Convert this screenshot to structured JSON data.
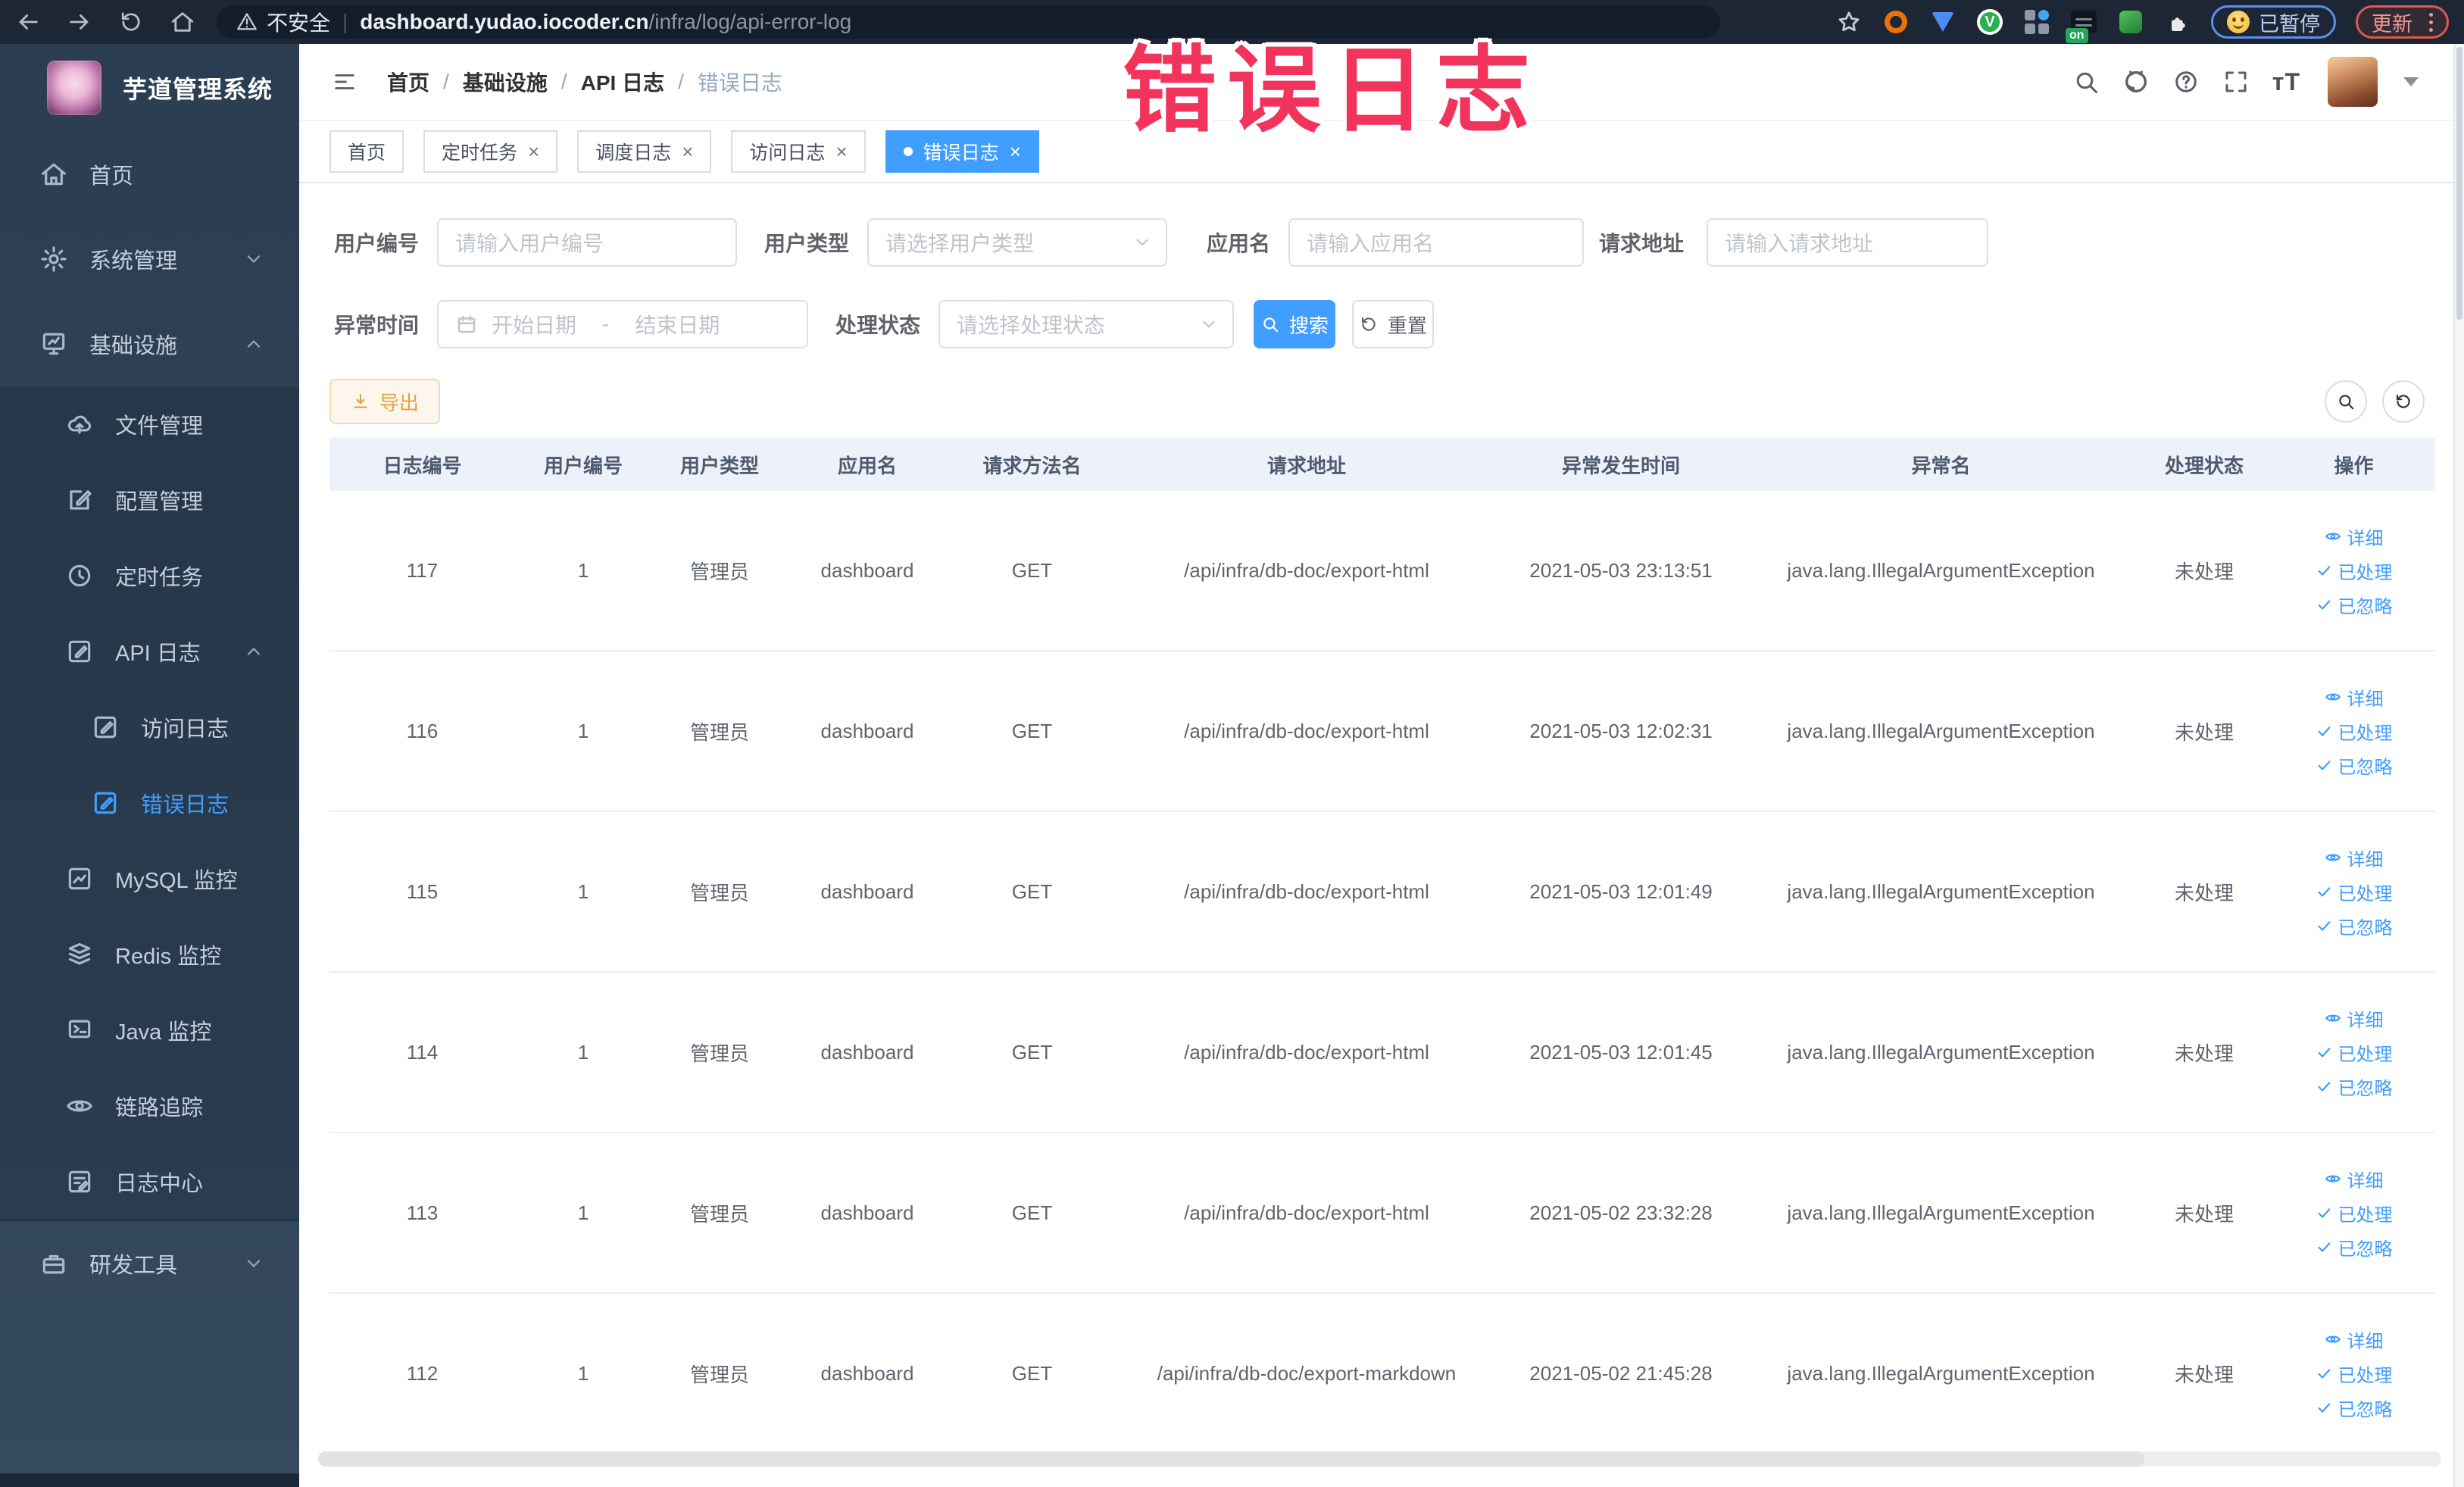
{
  "browser": {
    "security_label": "不安全",
    "url_host": "dashboard.yudao.iocoder.cn",
    "url_path": "/infra/log/api-error-log",
    "on_badge": "on",
    "paused_badge": "已暂停",
    "update_button": "更新"
  },
  "annotation": {
    "text": "错误日志",
    "color": "#f2345c"
  },
  "sidebar": {
    "title": "芋道管理系统",
    "menu": [
      {
        "label": "首页",
        "level": 1
      },
      {
        "label": "系统管理",
        "level": 1,
        "chevron": "down"
      },
      {
        "label": "基础设施",
        "level": 1,
        "chevron": "up"
      },
      {
        "label": "文件管理",
        "level": 2
      },
      {
        "label": "配置管理",
        "level": 2
      },
      {
        "label": "定时任务",
        "level": 2
      },
      {
        "label": "API 日志",
        "level": 2,
        "chevron": "up"
      },
      {
        "label": "访问日志",
        "level": 3
      },
      {
        "label": "错误日志",
        "level": 3,
        "active": true
      },
      {
        "label": "MySQL 监控",
        "level": 2
      },
      {
        "label": "Redis 监控",
        "level": 2
      },
      {
        "label": "Java 监控",
        "level": 2
      },
      {
        "label": "链路追踪",
        "level": 2
      },
      {
        "label": "日志中心",
        "level": 2
      },
      {
        "label": "研发工具",
        "level": 1,
        "chevron": "down"
      }
    ]
  },
  "header": {
    "breadcrumb": [
      "首页",
      "基础设施",
      "API 日志",
      "错误日志"
    ]
  },
  "tabs": [
    {
      "label": "首页",
      "closable": false,
      "active": false
    },
    {
      "label": "定时任务",
      "closable": true,
      "active": false
    },
    {
      "label": "调度日志",
      "closable": true,
      "active": false
    },
    {
      "label": "访问日志",
      "closable": true,
      "active": false
    },
    {
      "label": "错误日志",
      "closable": true,
      "active": true
    }
  ],
  "filters": {
    "user_id": {
      "label": "用户编号",
      "placeholder": "请输入用户编号"
    },
    "user_type": {
      "label": "用户类型",
      "placeholder": "请选择用户类型"
    },
    "app_name": {
      "label": "应用名",
      "placeholder": "请输入应用名"
    },
    "request_url": {
      "label": "请求地址",
      "placeholder": "请输入请求地址"
    },
    "exception_time": {
      "label": "异常时间",
      "start_placeholder": "开始日期",
      "separator": "-",
      "end_placeholder": "结束日期"
    },
    "process_status": {
      "label": "处理状态",
      "placeholder": "请选择处理状态"
    },
    "search_button": "搜索",
    "reset_button": "重置"
  },
  "toolbar": {
    "export_button": "导出"
  },
  "table": {
    "columns": [
      "日志编号",
      "用户编号",
      "用户类型",
      "应用名",
      "请求方法名",
      "请求地址",
      "异常发生时间",
      "异常名",
      "处理状态",
      "操作"
    ],
    "row_actions": [
      "详细",
      "已处理",
      "已忽略"
    ],
    "rows": [
      [
        "117",
        "1",
        "管理员",
        "dashboard",
        "GET",
        "/api/infra/db-doc/export-html",
        "2021-05-03 23:13:51",
        "java.lang.IllegalArgumentException",
        "未处理"
      ],
      [
        "116",
        "1",
        "管理员",
        "dashboard",
        "GET",
        "/api/infra/db-doc/export-html",
        "2021-05-03 12:02:31",
        "java.lang.IllegalArgumentException",
        "未处理"
      ],
      [
        "115",
        "1",
        "管理员",
        "dashboard",
        "GET",
        "/api/infra/db-doc/export-html",
        "2021-05-03 12:01:49",
        "java.lang.IllegalArgumentException",
        "未处理"
      ],
      [
        "114",
        "1",
        "管理员",
        "dashboard",
        "GET",
        "/api/infra/db-doc/export-html",
        "2021-05-03 12:01:45",
        "java.lang.IllegalArgumentException",
        "未处理"
      ],
      [
        "113",
        "1",
        "管理员",
        "dashboard",
        "GET",
        "/api/infra/db-doc/export-html",
        "2021-05-02 23:32:28",
        "java.lang.IllegalArgumentException",
        "未处理"
      ],
      [
        "112",
        "1",
        "管理员",
        "dashboard",
        "GET",
        "/api/infra/db-doc/export-markdown",
        "2021-05-02 21:45:28",
        "java.lang.IllegalArgumentException",
        "未处理"
      ]
    ]
  },
  "colors": {
    "accent": "#409eff",
    "warning": "#e6a23c",
    "annotation": "#f2345c",
    "sidebar": "#304156"
  }
}
